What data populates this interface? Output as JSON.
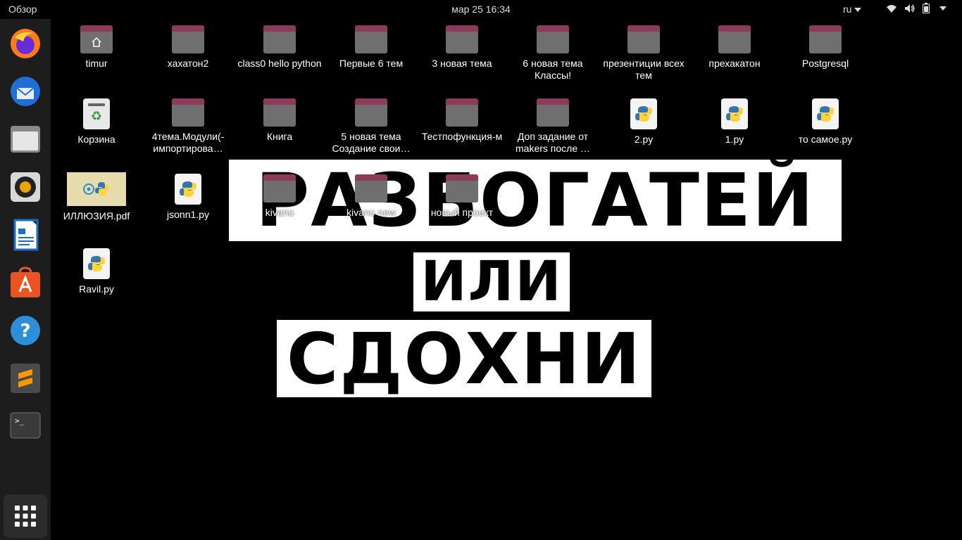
{
  "topbar": {
    "activities": "Обзор",
    "clock": "мар 25  16:34",
    "lang": "ru"
  },
  "dock": {
    "items": [
      {
        "name": "firefox"
      },
      {
        "name": "thunderbird"
      },
      {
        "name": "files"
      },
      {
        "name": "rhythmbox"
      },
      {
        "name": "libreoffice-writer"
      },
      {
        "name": "software-center"
      },
      {
        "name": "help"
      },
      {
        "name": "sublime-text"
      },
      {
        "name": "terminal"
      }
    ]
  },
  "wallpaper": {
    "line1": "РАЗБОГАТЕЙ",
    "line2": "ИЛИ",
    "line3": "СДОХНИ"
  },
  "desktop": {
    "icons": [
      {
        "label": "timur",
        "type": "home"
      },
      {
        "label": "хахатон2",
        "type": "folder"
      },
      {
        "label": "class0 hello python",
        "type": "folder"
      },
      {
        "label": "Первые 6 тем",
        "type": "folder"
      },
      {
        "label": "3 новая тема",
        "type": "folder"
      },
      {
        "label": "6 новая тема Классы!",
        "type": "folder"
      },
      {
        "label": "презентиции всех тем",
        "type": "folder"
      },
      {
        "label": "прехакатон",
        "type": "folder"
      },
      {
        "label": "Postgresql",
        "type": "folder"
      },
      {
        "label": "Корзина",
        "type": "trash"
      },
      {
        "label": "4тема.Модули(-импортирова…",
        "type": "folder"
      },
      {
        "label": "Книга",
        "type": "folder"
      },
      {
        "label": "5 новая тема Создание свои…",
        "type": "folder"
      },
      {
        "label": "Тестпофункция-м",
        "type": "folder"
      },
      {
        "label": "Доп задание от makers после …",
        "type": "folder"
      },
      {
        "label": "2.py",
        "type": "python"
      },
      {
        "label": "1.py",
        "type": "python"
      },
      {
        "label": "то самое.py",
        "type": "python"
      },
      {
        "label": "ИЛЛЮЗИЯ.pdf",
        "type": "pdf"
      },
      {
        "label": "jsonn1.py",
        "type": "python"
      },
      {
        "label": "kivano",
        "type": "folder"
      },
      {
        "label": "kivano new",
        "type": "folder"
      },
      {
        "label": "новый проект",
        "type": "folder"
      },
      {
        "label": "Ravil.py",
        "type": "python"
      }
    ]
  }
}
